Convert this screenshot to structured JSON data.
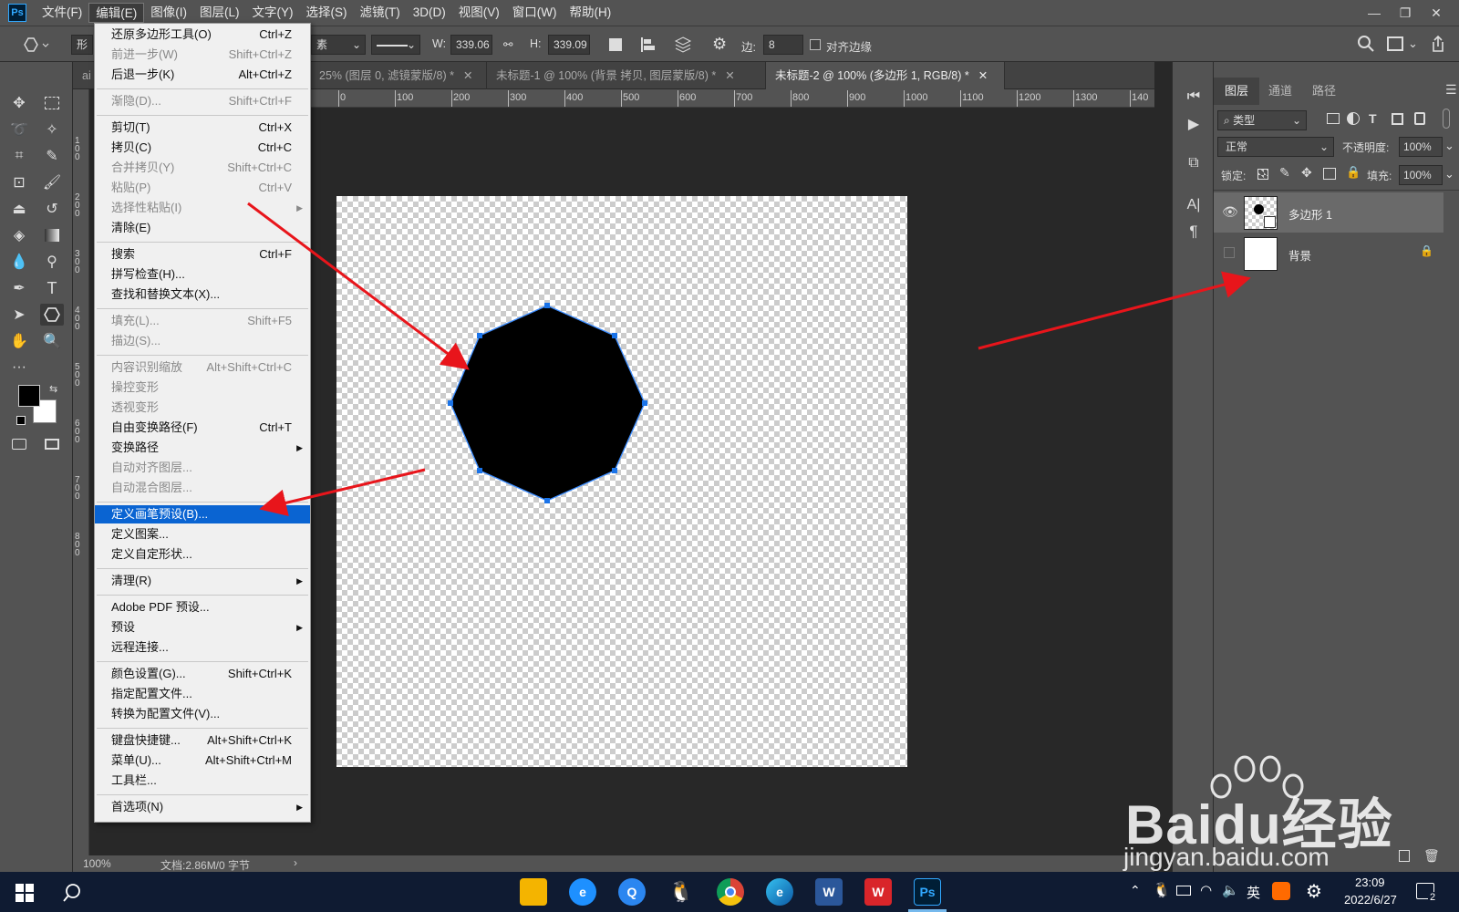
{
  "menubar": {
    "logo": "Ps",
    "items": [
      "文件(F)",
      "编辑(E)",
      "图像(I)",
      "图层(L)",
      "文字(Y)",
      "选择(S)",
      "滤镜(T)",
      "3D(D)",
      "视图(V)",
      "窗口(W)",
      "帮助(H)"
    ],
    "active_index": 1,
    "window_controls": [
      "—",
      "❐",
      "✕"
    ]
  },
  "options_bar": {
    "tool_mode": "形",
    "stroke_suffix": "素",
    "w_label": "W:",
    "w_value": "339.06",
    "h_label": "H:",
    "h_value": "339.09",
    "sides_label": "边:",
    "sides_value": "8",
    "align_edges_label": "对齐边缘"
  },
  "tabs": [
    {
      "label": "ai",
      "active": false
    },
    {
      "label": "25% (图层 0, 滤镜蒙版/8) *",
      "active": false
    },
    {
      "label": "未标题-1 @ 100% (背景 拷贝, 图层蒙版/8) *",
      "active": false
    },
    {
      "label": "未标题-2 @ 100% (多边形 1, RGB/8) *",
      "active": true
    }
  ],
  "ruler": {
    "h_labels": [
      "0",
      "100",
      "200",
      "300",
      "400",
      "500",
      "600",
      "700",
      "800",
      "900",
      "1000",
      "1100",
      "1200",
      "1300",
      "140"
    ],
    "v_labels": [
      "1 0 0",
      "2 0 0",
      "3 0 0",
      "4 0 0",
      "5 0 0",
      "6 0 0",
      "7 0 0",
      "8 0 0"
    ]
  },
  "edit_menu": {
    "items": [
      {
        "label": "还原多边形工具(O)",
        "shortcut": "Ctrl+Z",
        "disabled": false
      },
      {
        "label": "前进一步(W)",
        "shortcut": "Shift+Ctrl+Z",
        "disabled": true
      },
      {
        "label": "后退一步(K)",
        "shortcut": "Alt+Ctrl+Z",
        "disabled": false
      },
      {
        "separator": true
      },
      {
        "label": "渐隐(D)...",
        "shortcut": "Shift+Ctrl+F",
        "disabled": true
      },
      {
        "separator": true
      },
      {
        "label": "剪切(T)",
        "shortcut": "Ctrl+X",
        "disabled": false
      },
      {
        "label": "拷贝(C)",
        "shortcut": "Ctrl+C",
        "disabled": false
      },
      {
        "label": "合并拷贝(Y)",
        "shortcut": "Shift+Ctrl+C",
        "disabled": true
      },
      {
        "label": "粘贴(P)",
        "shortcut": "Ctrl+V",
        "disabled": true
      },
      {
        "label": "选择性粘贴(I)",
        "shortcut": "",
        "disabled": true,
        "submenu": true
      },
      {
        "label": "清除(E)",
        "shortcut": "",
        "disabled": false
      },
      {
        "separator": true
      },
      {
        "label": "搜索",
        "shortcut": "Ctrl+F",
        "disabled": false
      },
      {
        "label": "拼写检查(H)...",
        "shortcut": "",
        "disabled": false
      },
      {
        "label": "查找和替换文本(X)...",
        "shortcut": "",
        "disabled": false
      },
      {
        "separator": true
      },
      {
        "label": "填充(L)...",
        "shortcut": "Shift+F5",
        "disabled": true
      },
      {
        "label": "描边(S)...",
        "shortcut": "",
        "disabled": true
      },
      {
        "separator": true
      },
      {
        "label": "内容识别缩放",
        "shortcut": "Alt+Shift+Ctrl+C",
        "disabled": true
      },
      {
        "label": "操控变形",
        "shortcut": "",
        "disabled": true
      },
      {
        "label": "透视变形",
        "shortcut": "",
        "disabled": true
      },
      {
        "label": "自由变换路径(F)",
        "shortcut": "Ctrl+T",
        "disabled": false
      },
      {
        "label": "变换路径",
        "shortcut": "",
        "disabled": false,
        "submenu": true
      },
      {
        "label": "自动对齐图层...",
        "shortcut": "",
        "disabled": true
      },
      {
        "label": "自动混合图层...",
        "shortcut": "",
        "disabled": true
      },
      {
        "separator": true
      },
      {
        "label": "定义画笔预设(B)...",
        "shortcut": "",
        "disabled": false,
        "highlighted": true
      },
      {
        "label": "定义图案...",
        "shortcut": "",
        "disabled": false
      },
      {
        "label": "定义自定形状...",
        "shortcut": "",
        "disabled": false
      },
      {
        "separator": true
      },
      {
        "label": "清理(R)",
        "shortcut": "",
        "disabled": false,
        "submenu": true
      },
      {
        "separator": true
      },
      {
        "label": "Adobe PDF 预设...",
        "shortcut": "",
        "disabled": false
      },
      {
        "label": "预设",
        "shortcut": "",
        "disabled": false,
        "submenu": true
      },
      {
        "label": "远程连接...",
        "shortcut": "",
        "disabled": false
      },
      {
        "separator": true
      },
      {
        "label": "颜色设置(G)...",
        "shortcut": "Shift+Ctrl+K",
        "disabled": false
      },
      {
        "label": "指定配置文件...",
        "shortcut": "",
        "disabled": false
      },
      {
        "label": "转换为配置文件(V)...",
        "shortcut": "",
        "disabled": false
      },
      {
        "separator": true
      },
      {
        "label": "键盘快捷键...",
        "shortcut": "Alt+Shift+Ctrl+K",
        "disabled": false
      },
      {
        "label": "菜单(U)...",
        "shortcut": "Alt+Shift+Ctrl+M",
        "disabled": false
      },
      {
        "label": "工具栏...",
        "shortcut": "",
        "disabled": false
      },
      {
        "separator": true
      },
      {
        "label": "首选项(N)",
        "shortcut": "",
        "disabled": false,
        "submenu": true
      }
    ]
  },
  "layers_panel": {
    "tabs": [
      "图层",
      "通道",
      "路径"
    ],
    "filter_label": "类型",
    "blend_mode": "正常",
    "opacity_label": "不透明度:",
    "opacity_value": "100%",
    "lock_label": "锁定:",
    "fill_label": "填充:",
    "fill_value": "100%",
    "layers": [
      {
        "name": "多边形 1",
        "visible": true,
        "selected": true
      },
      {
        "name": "背景",
        "visible": false,
        "selected": false,
        "locked": true
      }
    ]
  },
  "status": {
    "zoom": "100%",
    "doc_info": "文档:2.86M/0 字节"
  },
  "taskbar": {
    "time": "23:09",
    "date": "2022/6/27",
    "ime": "英",
    "notification_count": "2"
  },
  "watermark": {
    "brand": "Baidu经验",
    "url": "jingyan.baidu.com"
  },
  "colors": {
    "annotation_arrow": "#e8151b",
    "menu_highlight": "#0a64d2",
    "selection_handle": "#1a73e8"
  }
}
